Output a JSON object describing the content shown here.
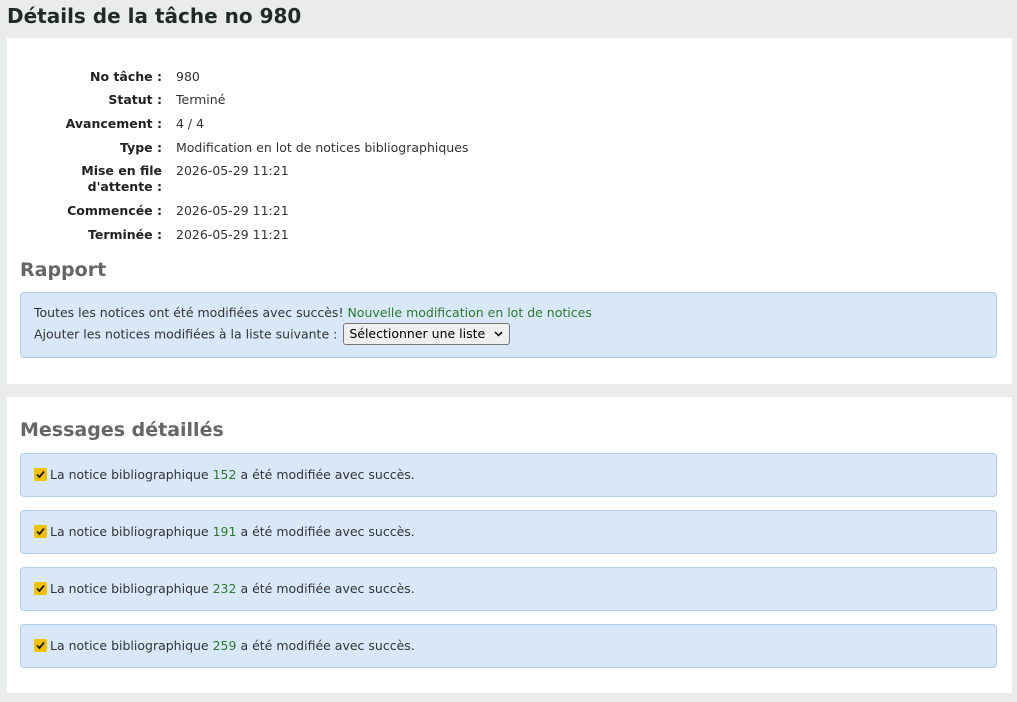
{
  "page": {
    "title": "Détails de la tâche no 980"
  },
  "details": {
    "fields": [
      {
        "label": "No tâche :",
        "value": "980"
      },
      {
        "label": "Statut :",
        "value": "Terminé"
      },
      {
        "label": "Avancement :",
        "value": "4 / 4"
      },
      {
        "label": "Type :",
        "value": "Modification en lot de notices bibliographiques"
      },
      {
        "label_line1": "Mise en file",
        "label_line2": "d'attente :",
        "value": "2026-05-29 11:21"
      },
      {
        "label": "Commencée :",
        "value": "2026-05-29 11:21"
      },
      {
        "label": "Terminée :",
        "value": "2026-05-29 11:21"
      }
    ]
  },
  "report": {
    "title": "Rapport",
    "success_text": "Toutes les notices ont été modifiées avec succès!",
    "new_batch_link": "Nouvelle modification en lot de notices",
    "add_to_list_label": "Ajouter les notices modifiées à la liste suivante :",
    "list_select_value": "Sélectionner une liste"
  },
  "messages": {
    "title": "Messages détaillés",
    "items": [
      {
        "prefix": "La notice bibliographique",
        "biblio": "152",
        "suffix": "a été modifiée avec succès."
      },
      {
        "prefix": "La notice bibliographique",
        "biblio": "191",
        "suffix": "a été modifiée avec succès."
      },
      {
        "prefix": "La notice bibliographique",
        "biblio": "232",
        "suffix": "a été modifiée avec succès."
      },
      {
        "prefix": "La notice bibliographique",
        "biblio": "259",
        "suffix": "a été modifiée avec succès."
      }
    ]
  },
  "colors": {
    "link": "#2c7a2f",
    "alert_bg": "#d9e8f9",
    "check": "#f2c200"
  },
  "icons": {
    "check": "check-square-icon",
    "select": "chevron-down-icon"
  }
}
